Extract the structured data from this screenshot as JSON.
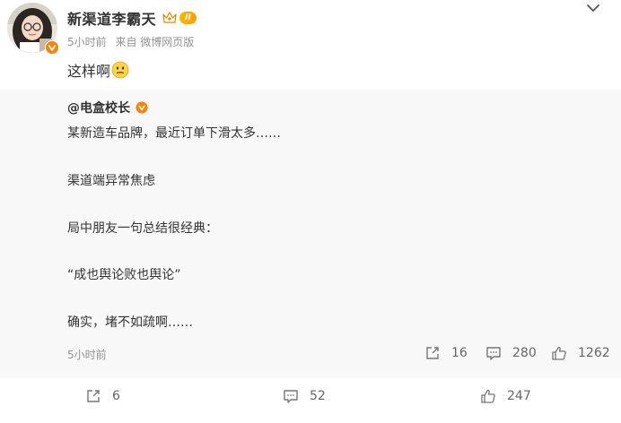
{
  "user": {
    "name": "新渠道李霸天",
    "level_badge": "II",
    "time": "5小时前",
    "source": "来自 微博网页版"
  },
  "post": {
    "text": "这样啊"
  },
  "repost": {
    "author": "@电盒校长",
    "lines": [
      "某新造车品牌，最近订单下滑太多……",
      "渠道端异常焦虑",
      "局中朋友一句总结很经典：",
      "“成也舆论败也舆论”",
      "确实，堵不如疏啊……"
    ],
    "time": "5小时前",
    "shares": "16",
    "comments": "280",
    "likes": "1262"
  },
  "footer": {
    "shares": "6",
    "comments": "52",
    "likes": "247"
  },
  "icons": {
    "more": "chevron-down-icon",
    "share": "share-icon",
    "comment": "comment-icon",
    "like": "thumbs-up-icon",
    "verified": "verified-badge-icon",
    "crown": "crown-icon",
    "emoji": "thinking-face-emoji"
  },
  "colors": {
    "verified": "#ff8200",
    "level": "#ffb800",
    "meta_gray": "#939393",
    "repost_bg": "#f8f8f8"
  }
}
